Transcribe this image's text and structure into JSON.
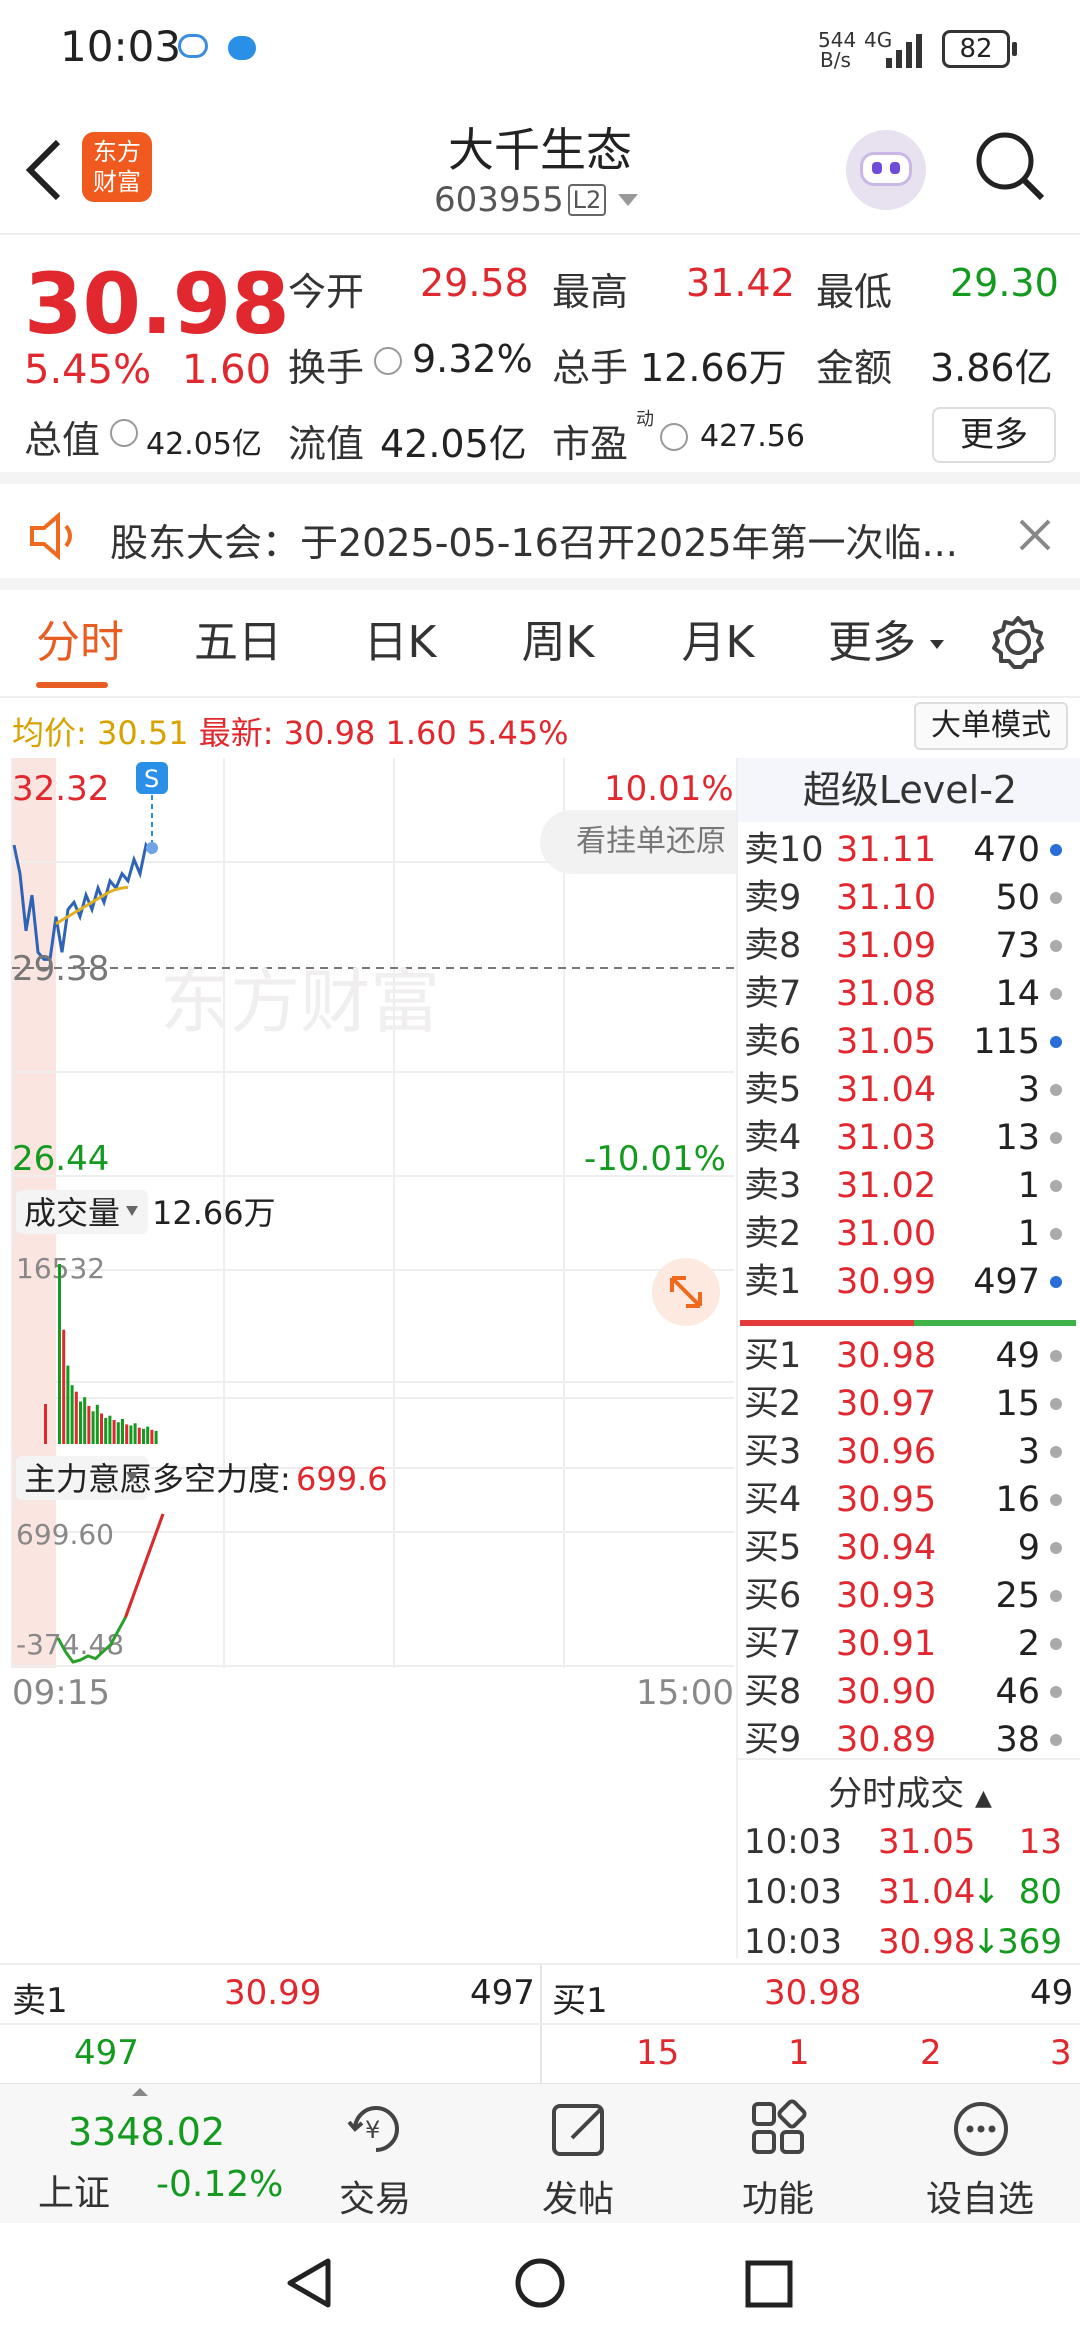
{
  "status": {
    "time": "10:03",
    "net_speed_top": "544",
    "net_speed_bottom": "B/s",
    "network": "4G",
    "battery": "82"
  },
  "header": {
    "stock_name": "大千生态",
    "stock_code": "603955",
    "level_badge": "L2",
    "logo_text_top": "东方",
    "logo_text_bottom": "财富"
  },
  "quote": {
    "price": "30.98",
    "change_pct": "5.45%",
    "change": "1.60",
    "open_label": "今开",
    "open": "29.58",
    "high_label": "最高",
    "high": "31.42",
    "low_label": "最低",
    "low": "29.30",
    "turnover_label": "换手",
    "turnover": "9.32%",
    "volume_label": "总手",
    "volume": "12.66万",
    "amount_label": "金额",
    "amount": "3.86亿",
    "mcap_label": "总值",
    "mcap": "42.05亿",
    "float_label": "流值",
    "float": "42.05亿",
    "pe_label": "市盈",
    "pe_sup": "动",
    "pe": "427.56",
    "more_button": "更多"
  },
  "notice": {
    "text": "股东大会：于2025-05-16召开2025年第一次临..."
  },
  "tabs": {
    "items": [
      "分时",
      "五日",
      "日K",
      "周K",
      "月K",
      "更多"
    ],
    "active": 0
  },
  "chart_info": {
    "avg_label": "均价:",
    "avg": "30.51",
    "latest_label": "最新:",
    "latest": "30.98",
    "latest_change": "1.60",
    "latest_pct": "5.45%",
    "big_order_button": "大单模式",
    "y_top": "32.32",
    "y_mid": "29.38",
    "y_bottom": "26.44",
    "pct_top": "10.01%",
    "pct_bottom": "-10.01%",
    "overlay_text": "看挂单还原",
    "vol_label": "成交量",
    "vol_value": "12.66万",
    "vol_max": "16532",
    "ind_label": "主力意愿",
    "ind_sub_label": "多空力度:",
    "ind_value": "699.6",
    "ind_top": "699.60",
    "ind_bottom": "-374.48",
    "time_start": "09:15",
    "time_end": "15:00",
    "watermark": "东方财富",
    "s_marker": "S"
  },
  "chart_data": [
    {
      "type": "line",
      "title": "",
      "series": [
        {
          "name": "",
          "values": [
            31.1,
            30.7,
            29.9,
            30.4,
            29.6,
            29.5,
            29.5,
            30.1,
            29.6,
            30.2,
            30.3,
            30.1,
            30.4,
            30.2,
            30.5,
            30.3,
            30.6,
            30.5,
            30.7,
            30.6,
            30.9,
            30.7,
            31.1,
            30.98
          ]
        },
        {
          "name": "均价",
          "values": [
            null,
            null,
            null,
            null,
            null,
            null,
            null,
            30.0,
            30.05,
            30.1,
            30.15,
            30.2,
            30.25,
            30.3,
            30.35,
            30.4,
            30.45,
            30.48,
            30.5,
            30.51
          ]
        }
      ],
      "ylim": [
        26.44,
        32.32
      ],
      "xlabel": "",
      "ylabel": ""
    },
    {
      "type": "bar",
      "title": "",
      "series": [
        {
          "name": "成交量",
          "values": [
            16532,
            10500,
            7200,
            5400,
            4800,
            3900,
            4300,
            3500,
            3000,
            3600,
            2800,
            2400,
            2600,
            2200,
            2000,
            2300,
            1800,
            1700,
            1900,
            1500,
            1400,
            1600,
            1300,
            1200
          ]
        }
      ],
      "ylim": [
        0,
        16532
      ]
    },
    {
      "type": "line",
      "title": "",
      "series": [
        {
          "name": "多空力度",
          "values": [
            -200,
            -300,
            -374.48,
            -360,
            -330,
            -350,
            -300,
            -250,
            -150,
            -50,
            100,
            250,
            400,
            550,
            699.6
          ]
        }
      ],
      "ylim": [
        -374.48,
        699.6
      ]
    }
  ],
  "orderbook": {
    "title": "超级Level-2",
    "asks": [
      {
        "label": "卖10",
        "price": "31.11",
        "vol": "470",
        "dot": "#2a6fd8"
      },
      {
        "label": "卖9",
        "price": "31.10",
        "vol": "50",
        "dot": "#aaaaaa"
      },
      {
        "label": "卖8",
        "price": "31.09",
        "vol": "73",
        "dot": "#aaaaaa"
      },
      {
        "label": "卖7",
        "price": "31.08",
        "vol": "14",
        "dot": "#aaaaaa"
      },
      {
        "label": "卖6",
        "price": "31.05",
        "vol": "115",
        "dot": "#2a6fd8"
      },
      {
        "label": "卖5",
        "price": "31.04",
        "vol": "3",
        "dot": "#aaaaaa"
      },
      {
        "label": "卖4",
        "price": "31.03",
        "vol": "13",
        "dot": "#aaaaaa"
      },
      {
        "label": "卖3",
        "price": "31.02",
        "vol": "1",
        "dot": "#aaaaaa"
      },
      {
        "label": "卖2",
        "price": "31.00",
        "vol": "1",
        "dot": "#aaaaaa"
      },
      {
        "label": "卖1",
        "price": "30.99",
        "vol": "497",
        "dot": "#2a6fd8"
      }
    ],
    "bids": [
      {
        "label": "买1",
        "price": "30.98",
        "vol": "49",
        "dot": "#aaaaaa"
      },
      {
        "label": "买2",
        "price": "30.97",
        "vol": "15",
        "dot": "#aaaaaa"
      },
      {
        "label": "买3",
        "price": "30.96",
        "vol": "3",
        "dot": "#aaaaaa"
      },
      {
        "label": "买4",
        "price": "30.95",
        "vol": "16",
        "dot": "#aaaaaa"
      },
      {
        "label": "买5",
        "price": "30.94",
        "vol": "9",
        "dot": "#aaaaaa"
      },
      {
        "label": "买6",
        "price": "30.93",
        "vol": "25",
        "dot": "#aaaaaa"
      },
      {
        "label": "买7",
        "price": "30.91",
        "vol": "2",
        "dot": "#aaaaaa"
      },
      {
        "label": "买8",
        "price": "30.90",
        "vol": "46",
        "dot": "#aaaaaa"
      },
      {
        "label": "买9",
        "price": "30.89",
        "vol": "38",
        "dot": "#aaaaaa"
      }
    ],
    "ticks_title": "分时成交",
    "ticks": [
      {
        "time": "10:03",
        "price": "31.05",
        "arrow": "",
        "vol": "13",
        "vol_color": "#e0282e"
      },
      {
        "time": "10:03",
        "price": "31.04",
        "arrow": "↓",
        "vol": "80",
        "vol_color": "#139a1f"
      },
      {
        "time": "10:03",
        "price": "30.98",
        "arrow": "↓",
        "vol": "369",
        "vol_color": "#139a1f"
      }
    ]
  },
  "bottom_quotes": {
    "ask_label": "卖1",
    "ask_price": "30.99",
    "ask_vol": "497",
    "ask_queue": [
      "497"
    ],
    "bid_label": "买1",
    "bid_price": "30.98",
    "bid_vol": "49",
    "bid_queue": [
      "15",
      "1",
      "2",
      "3"
    ]
  },
  "bottom_nav": {
    "index_value": "3348.02",
    "index_name": "上证",
    "index_change": "-0.12%",
    "items": [
      "交易",
      "发帖",
      "功能",
      "设自选"
    ]
  }
}
